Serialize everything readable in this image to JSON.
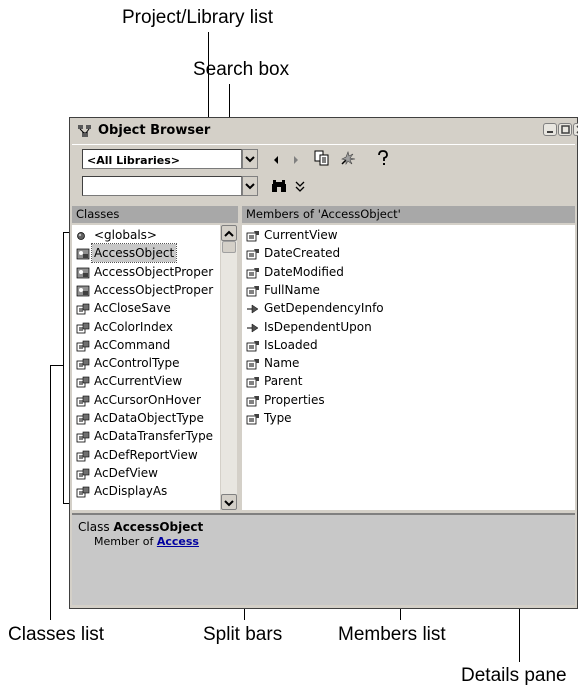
{
  "callouts": {
    "project_library_list": "Project/Library list",
    "search_box": "Search box",
    "classes_list": "Classes list",
    "split_bars": "Split bars",
    "members_list": "Members list",
    "details_pane": "Details pane"
  },
  "window": {
    "title": "Object Browser",
    "library_combo_value": "<All Libraries>",
    "search_combo_value": ""
  },
  "classes_pane": {
    "header": "Classes",
    "items": [
      {
        "label": "<globals>",
        "icon": "globals-icon"
      },
      {
        "label": "AccessObject",
        "icon": "class-module-icon",
        "selected": true
      },
      {
        "label": "AccessObjectProper",
        "icon": "class-module-icon"
      },
      {
        "label": "AccessObjectProper",
        "icon": "class-module-icon"
      },
      {
        "label": "AcCloseSave",
        "icon": "enum-icon"
      },
      {
        "label": "AcColorIndex",
        "icon": "enum-icon"
      },
      {
        "label": "AcCommand",
        "icon": "enum-icon"
      },
      {
        "label": "AcControlType",
        "icon": "enum-icon"
      },
      {
        "label": "AcCurrentView",
        "icon": "enum-icon"
      },
      {
        "label": "AcCursorOnHover",
        "icon": "enum-icon"
      },
      {
        "label": "AcDataObjectType",
        "icon": "enum-icon"
      },
      {
        "label": "AcDataTransferType",
        "icon": "enum-icon"
      },
      {
        "label": "AcDefReportView",
        "icon": "enum-icon"
      },
      {
        "label": "AcDefView",
        "icon": "enum-icon"
      },
      {
        "label": "AcDisplayAs",
        "icon": "enum-icon"
      }
    ]
  },
  "members_pane": {
    "header": "Members of 'AccessObject'",
    "items": [
      {
        "label": "CurrentView",
        "icon": "property-icon"
      },
      {
        "label": "DateCreated",
        "icon": "property-icon"
      },
      {
        "label": "DateModified",
        "icon": "property-icon"
      },
      {
        "label": "FullName",
        "icon": "property-icon"
      },
      {
        "label": "GetDependencyInfo",
        "icon": "method-icon"
      },
      {
        "label": "IsDependentUpon",
        "icon": "method-icon"
      },
      {
        "label": "IsLoaded",
        "icon": "property-icon"
      },
      {
        "label": "Name",
        "icon": "property-icon"
      },
      {
        "label": "Parent",
        "icon": "property-icon"
      },
      {
        "label": "Properties",
        "icon": "property-icon"
      },
      {
        "label": "Type",
        "icon": "property-icon"
      }
    ]
  },
  "details_pane": {
    "class_prefix": "Class",
    "class_name": "AccessObject",
    "member_of_prefix": "Member of",
    "member_of_link": "Access"
  }
}
